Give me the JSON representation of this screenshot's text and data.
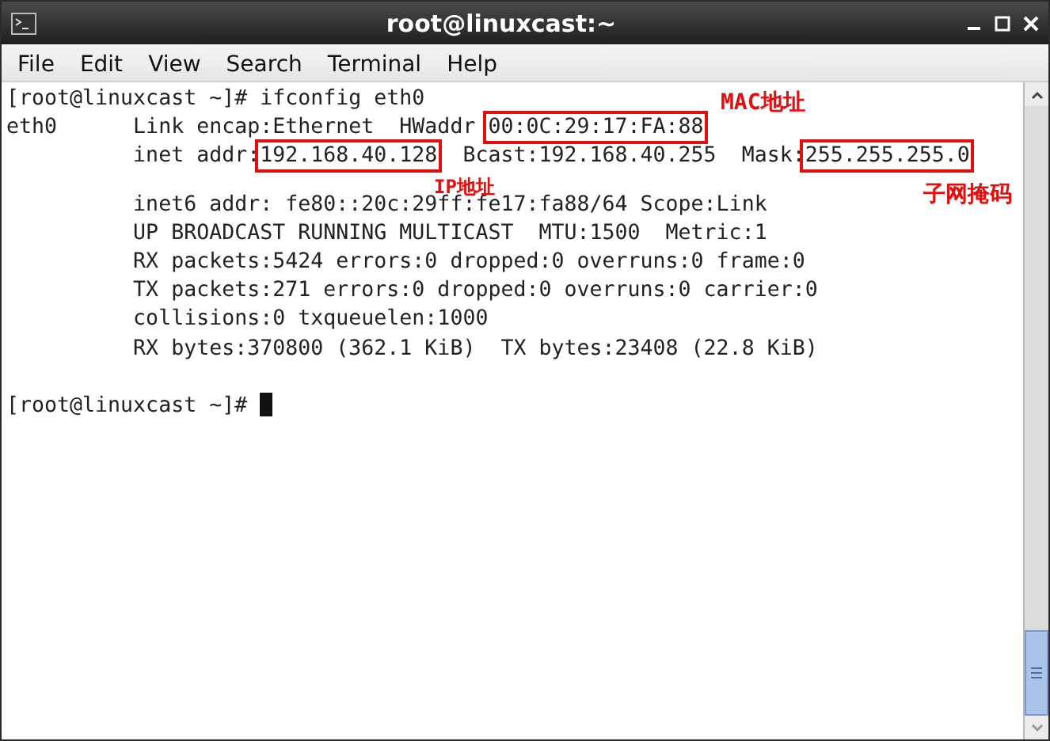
{
  "window": {
    "title": "root@linuxcast:~"
  },
  "menu": [
    "File",
    "Edit",
    "View",
    "Search",
    "Terminal",
    "Help"
  ],
  "terminal": {
    "lines": [
      {
        "kind": "plain",
        "text": "[root@linuxcast ~]# ifconfig eth0"
      },
      {
        "kind": "marked",
        "segments": [
          {
            "text": "eth0      Link encap:Ethernet  HWaddr ",
            "boxed": false
          },
          {
            "text": "00:0C:29:17:FA:88",
            "boxed": true
          }
        ]
      },
      {
        "kind": "marked",
        "segments": [
          {
            "text": "          inet addr:",
            "boxed": false
          },
          {
            "text": "192.168.40.128",
            "boxed": true
          },
          {
            "text": "  Bcast:192.168.40.255  Mask:",
            "boxed": false
          },
          {
            "text": "255.255.255.0",
            "boxed": true
          }
        ]
      },
      {
        "kind": "plain",
        "text": "          inet6 addr: fe80::20c:29ff:fe17:fa88/64 Scope:Link"
      },
      {
        "kind": "plain",
        "text": "          UP BROADCAST RUNNING MULTICAST  MTU:1500  Metric:1"
      },
      {
        "kind": "plain",
        "text": "          RX packets:5424 errors:0 dropped:0 overruns:0 frame:0"
      },
      {
        "kind": "plain",
        "text": "          TX packets:271 errors:0 dropped:0 overruns:0 carrier:0"
      },
      {
        "kind": "plain",
        "text": "          collisions:0 txqueuelen:1000"
      },
      {
        "kind": "plain",
        "text": "          RX bytes:370800 (362.1 KiB)  TX bytes:23408 (22.8 KiB)"
      },
      {
        "kind": "plain",
        "text": "[root@linuxcast ~]# "
      }
    ],
    "cursor": true
  },
  "annotations": [
    "MAC地址",
    "IP地址",
    "子网掩码"
  ]
}
